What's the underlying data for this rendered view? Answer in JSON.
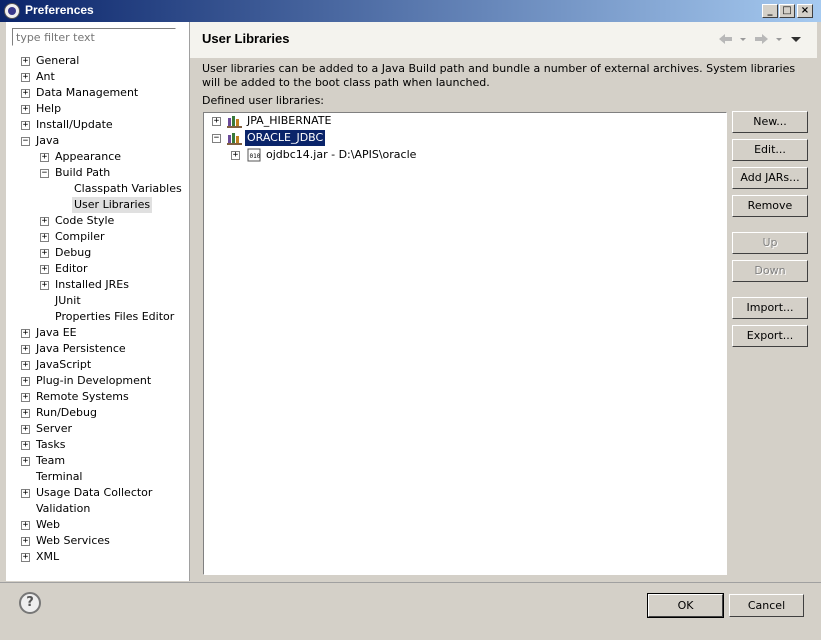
{
  "window": {
    "title": "Preferences"
  },
  "filter": {
    "placeholder": "type filter text"
  },
  "nav": {
    "items": [
      {
        "label": "General"
      },
      {
        "label": "Ant"
      },
      {
        "label": "Data Management"
      },
      {
        "label": "Help"
      },
      {
        "label": "Install/Update"
      },
      {
        "label": "Java"
      },
      {
        "label": "Appearance"
      },
      {
        "label": "Build Path"
      },
      {
        "label": "Classpath Variables"
      },
      {
        "label": "User Libraries"
      },
      {
        "label": "Code Style"
      },
      {
        "label": "Compiler"
      },
      {
        "label": "Debug"
      },
      {
        "label": "Editor"
      },
      {
        "label": "Installed JREs"
      },
      {
        "label": "JUnit"
      },
      {
        "label": "Properties Files Editor"
      },
      {
        "label": "Java EE"
      },
      {
        "label": "Java Persistence"
      },
      {
        "label": "JavaScript"
      },
      {
        "label": "Plug-in Development"
      },
      {
        "label": "Remote Systems"
      },
      {
        "label": "Run/Debug"
      },
      {
        "label": "Server"
      },
      {
        "label": "Tasks"
      },
      {
        "label": "Team"
      },
      {
        "label": "Terminal"
      },
      {
        "label": "Usage Data Collector"
      },
      {
        "label": "Validation"
      },
      {
        "label": "Web"
      },
      {
        "label": "Web Services"
      },
      {
        "label": "XML"
      }
    ]
  },
  "page": {
    "title": "User Libraries",
    "description": "User libraries can be added to a Java Build path and bundle a number of external archives. System libraries will be added to the boot class path when launched.",
    "defined_label": "Defined user libraries:"
  },
  "libraries": [
    {
      "label": "JPA_HIBERNATE"
    },
    {
      "label": "ORACLE_JDBC"
    },
    {
      "label": "ojdbc14.jar - D:\\APIS\\oracle"
    }
  ],
  "buttons": {
    "new": "New...",
    "edit": "Edit...",
    "add_jars": "Add JARs...",
    "remove": "Remove",
    "up": "Up",
    "down": "Down",
    "import": "Import...",
    "export": "Export..."
  },
  "footer": {
    "ok": "OK",
    "cancel": "Cancel",
    "help_glyph": "?"
  },
  "colors": {
    "selection": "#0a246a",
    "titlebar": "#0a246a"
  }
}
